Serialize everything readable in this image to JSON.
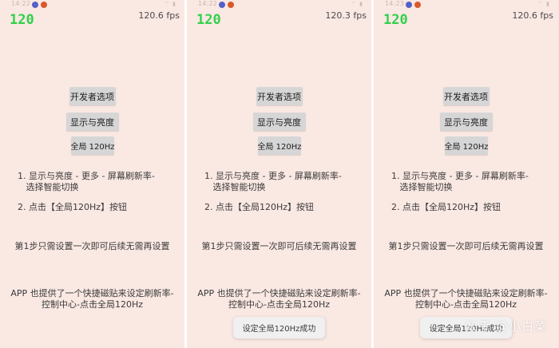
{
  "screens": [
    {
      "status_time": "14:22",
      "fps_counter": "120",
      "fps_label": "120.6 fps",
      "btn_developer": "开发者选项",
      "btn_display": "显示与亮度",
      "btn_global": "全局 120Hz",
      "instruction_1": "1. 显示与亮度 - 更多 - 屏幕刷新率-\n   选择智能切换",
      "instruction_2": "2. 点击【全局120Hz】按钮",
      "note_once": "第1步只需设置一次即可后续无需再设置",
      "note_app": "APP 也提供了一个快捷磁贴来设定刷新率-\n控制中心-点击全局120Hz"
    },
    {
      "status_time": "14:22",
      "fps_counter": "120",
      "fps_label": "120.3 fps",
      "btn_developer": "开发者选项",
      "btn_display": "显示与亮度",
      "btn_global": "全局 120Hz",
      "instruction_1": "1. 显示与亮度 - 更多 - 屏幕刷新率-\n   选择智能切换",
      "instruction_2": "2. 点击【全局120Hz】按钮",
      "note_once": "第1步只需设置一次即可后续无需再设置",
      "note_app": "APP 也提供了一个快捷磁贴来设定刷新率-\n控制中心-点击全局120Hz",
      "toast": "设定全局120Hz成功"
    },
    {
      "status_time": "14:23",
      "fps_counter": "120",
      "fps_label": "120.6 fps",
      "btn_developer": "开发者选项",
      "btn_display": "显示与亮度",
      "btn_global": "全局 120Hz",
      "instruction_1": "1. 显示与亮度 - 更多 - 屏幕刷新率-\n   选择智能切换",
      "instruction_2": "2. 点击【全局120Hz】按钮",
      "note_once": "第1步只需设置一次即可后续无需再设置",
      "note_app": "APP 也提供了一个快捷磁贴来设定刷新率-\n控制中心-点击全局120Hz",
      "toast": "设定全局120Hz成功"
    }
  ],
  "watermark": "知乎 @小白菜",
  "colors": {
    "background": "#fae8e3",
    "fps_counter": "#32d14a",
    "button": "#d6d6d6",
    "text": "#3b3b3b"
  }
}
